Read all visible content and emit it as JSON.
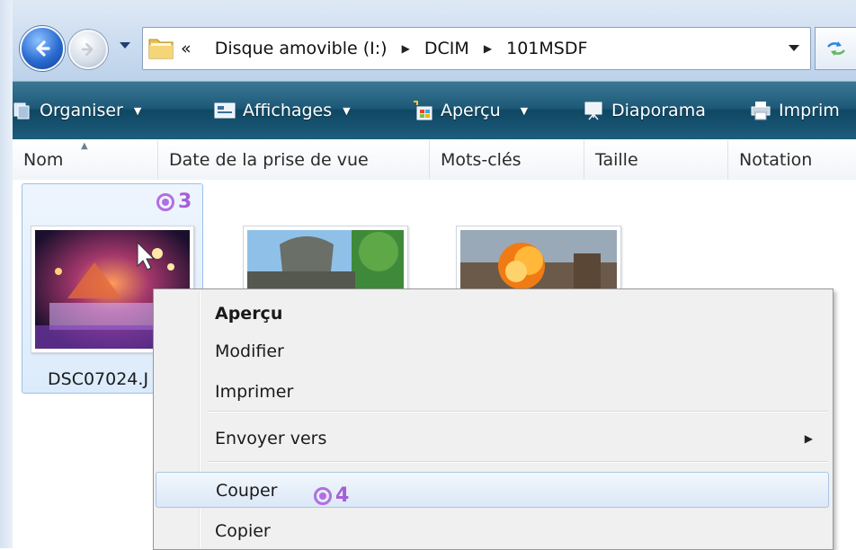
{
  "address_bar": {
    "prefix": "«",
    "path": [
      "Disque amovible (I:)",
      "DCIM",
      "101MSDF"
    ]
  },
  "toolbar": {
    "organiser": "Organiser",
    "affichages": "Affichages",
    "apercu": "Aperçu",
    "diaporama": "Diaporama",
    "imprimer": "Imprim"
  },
  "columns": [
    "Nom",
    "Date de la prise de vue",
    "Mots-clés",
    "Taille",
    "Notation"
  ],
  "files": [
    {
      "name": "DSC07024.J",
      "selected": true
    }
  ],
  "steps": {
    "select_step": "3",
    "cut_step": "4"
  },
  "context_menu": {
    "items": [
      "Aperçu",
      "Modifier",
      "Imprimer",
      "Envoyer vers",
      "Couper",
      "Copier"
    ],
    "default_item": "Aperçu",
    "highlighted_item": "Couper",
    "submenu_item": "Envoyer vers"
  },
  "colors": {
    "toolbar": "#1e5a78",
    "selection": "#dcebfb",
    "step_badge": "#a65fd6"
  }
}
